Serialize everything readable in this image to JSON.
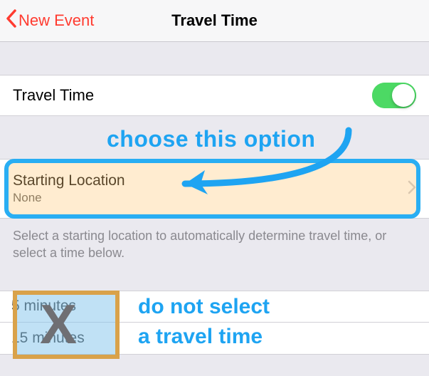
{
  "header": {
    "back_label": "New Event",
    "title": "Travel Time"
  },
  "travel_time_row": {
    "label": "Travel Time",
    "switch_on": true
  },
  "annotations": {
    "choose": "choose this option",
    "do_not_1": "do not select",
    "do_not_2": "a travel time",
    "x_mark": "X"
  },
  "starting": {
    "title": "Starting Location",
    "value": "None"
  },
  "hint": "Select a starting location to automatically determine travel time, or select a time below.",
  "options": [
    "5 minutes",
    "15 minutes"
  ]
}
